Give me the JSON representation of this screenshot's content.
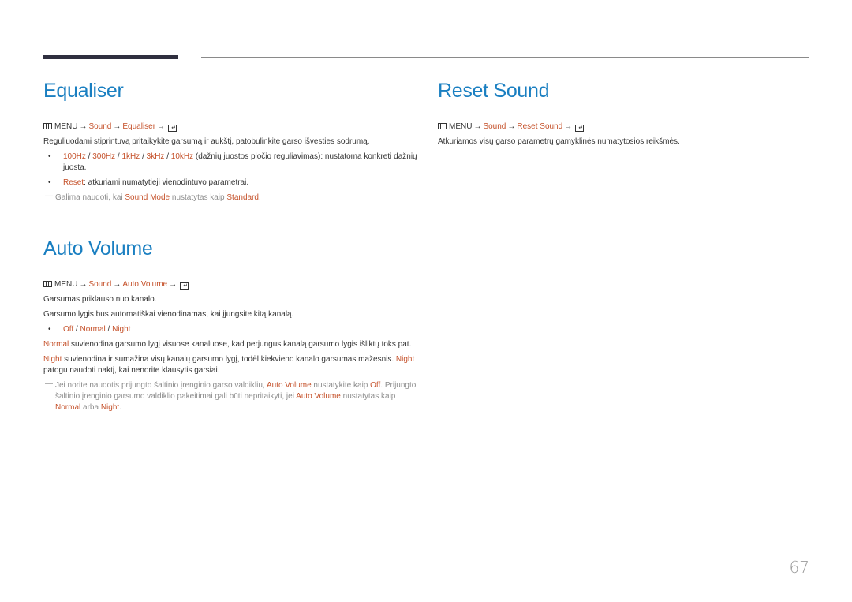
{
  "colors": {
    "heading": "#1a7fc1",
    "highlight": "#c5512a",
    "text": "#333333",
    "note": "#8c8c8c"
  },
  "sections": {
    "equaliser": {
      "title": "Equaliser",
      "menu": {
        "menu_label": "MENU",
        "arrow": "→",
        "path": [
          "Sound",
          "Equaliser"
        ],
        "menu_icon": "menu-icon",
        "enter_icon": "enter-icon"
      },
      "description": "Reguliuodami stiprintuvą pritaikykite garsumą ir aukštį, patobulinkite garso išvesties sodrumą.",
      "bullets": [
        {
          "options": [
            "100Hz",
            "300Hz",
            "1kHz",
            "3kHz",
            "10kHz"
          ],
          "separator": " / ",
          "text": " (dažnių juostos pločio reguliavimas): nustatoma konkreti dažnių juosta."
        },
        {
          "label": "Reset",
          "text": ": atkuriami numatytieji vienodintuvo parametrai."
        }
      ],
      "note": {
        "pre": "Galima naudoti, kai ",
        "hl1": "Sound Mode",
        "mid": " nustatytas kaip ",
        "hl2": "Standard",
        "post": "."
      }
    },
    "auto_volume": {
      "title": "Auto Volume",
      "menu": {
        "menu_label": "MENU",
        "arrow": "→",
        "path": [
          "Sound",
          "Auto Volume"
        ]
      },
      "paragraphs": [
        "Garsumas priklauso nuo kanalo.",
        "Garsumo lygis bus automatiškai vienodinamas, kai įjungsite kitą kanalą."
      ],
      "options": [
        "Off",
        "Normal",
        "Night"
      ],
      "normal_desc": {
        "hl": "Normal",
        "text": " suvienodina garsumo lygį visuose kanaluose, kad perjungus kanalą garsumo lygis išliktų toks pat."
      },
      "night_desc": {
        "hl1": "Night",
        "text1": " suvienodina ir sumažina visų kanalų garsumo lygį, todėl kiekvieno kanalo garsumas mažesnis. ",
        "hl2": "Night",
        "text2": " patogu naudoti naktį, kai nenorite klausytis garsiai."
      },
      "note": {
        "t1": "Jei norite naudotis prijungto šaltinio įrenginio garso valdikliu, ",
        "h1": "Auto Volume",
        "t2": " nustatykite kaip ",
        "h2": "Off",
        "t3": ". Prijungto šaltinio įrenginio garsumo valdiklio pakeitimai gali būti nepritaikyti, jei ",
        "h3": "Auto Volume",
        "t4": " nustatytas kaip ",
        "h4": "Normal",
        "t5": " arba ",
        "h5": "Night",
        "t6": "."
      }
    },
    "reset_sound": {
      "title": "Reset Sound",
      "menu": {
        "menu_label": "MENU",
        "arrow": "→",
        "path": [
          "Sound",
          "Reset Sound"
        ]
      },
      "description": "Atkuriamos visų garso parametrų gamyklinės numatytosios reikšmės."
    }
  },
  "page_number": "67",
  "glyphs": {
    "bullet": "•",
    "note_dash": "―",
    "slash": " / ",
    "enter": "↵"
  }
}
